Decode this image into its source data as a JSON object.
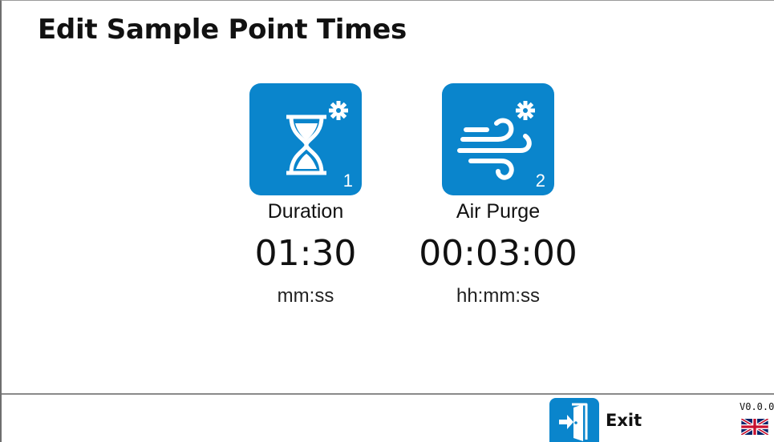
{
  "page": {
    "title": "Edit Sample Point Times"
  },
  "tiles": [
    {
      "icon": "hourglass-settings-icon",
      "index": "1",
      "label": "Duration",
      "value": "01:30",
      "unit": "mm:ss"
    },
    {
      "icon": "air-wind-settings-icon",
      "index": "2",
      "label": "Air Purge",
      "value": "00:03:00",
      "unit": "hh:mm:ss"
    }
  ],
  "footer": {
    "exit_label": "Exit",
    "exit_icon": "exit-door-icon",
    "version": "V0.0.0",
    "language_icon": "uk-flag-icon"
  },
  "colors": {
    "accent": "#0a85cc",
    "text": "#111111",
    "background": "#ffffff",
    "divider": "#8a8a8a"
  }
}
